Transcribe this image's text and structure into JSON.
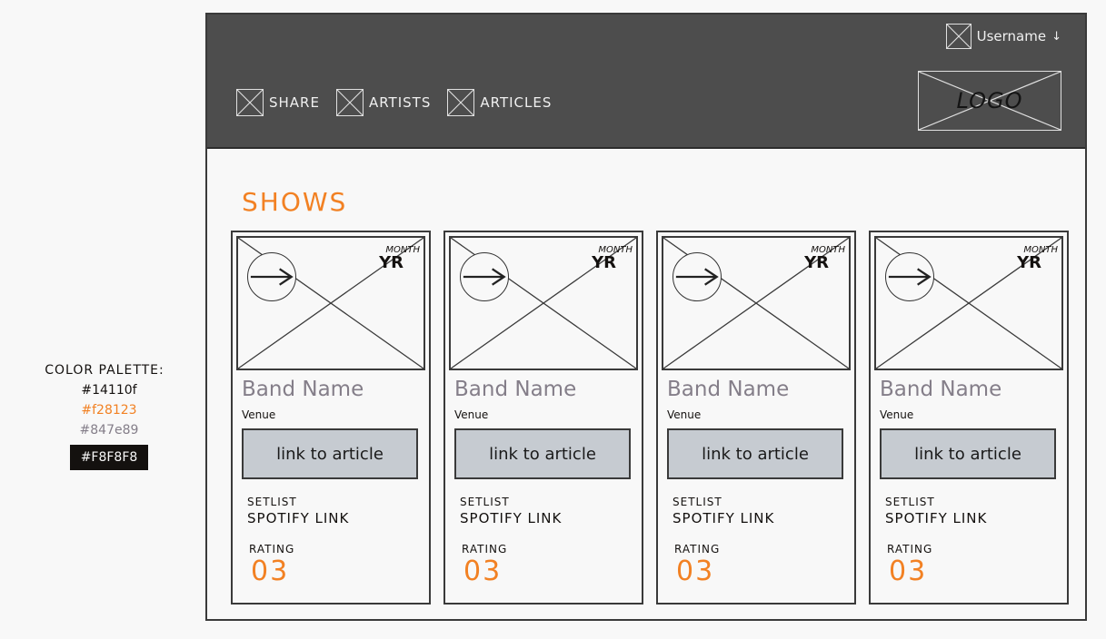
{
  "palette": {
    "title": "COLOR PALETTE:",
    "swatches": [
      "#14110f",
      "#f28123",
      "#847e89",
      "#F8F8F8"
    ]
  },
  "header": {
    "username": "Username",
    "caret": "↓",
    "nav": [
      {
        "label": "SHARE",
        "icon": "image-placeholder-icon"
      },
      {
        "label": "ARTISTS",
        "icon": "image-placeholder-icon"
      },
      {
        "label": "ARTICLES",
        "icon": "image-placeholder-icon"
      }
    ],
    "logo": "LOGO"
  },
  "main": {
    "section_title": "SHOWS",
    "cards": [
      {
        "month": "MONTH",
        "year": "YR",
        "band": "Band Name",
        "venue": "Venue",
        "link_label": "link to article",
        "setlist": "SETLIST",
        "spotify": "SPOTIFY LINK",
        "rating_label": "RATING",
        "rating": "03"
      },
      {
        "month": "MONTH",
        "year": "YR",
        "band": "Band Name",
        "venue": "Venue",
        "link_label": "link to article",
        "setlist": "SETLIST",
        "spotify": "SPOTIFY LINK",
        "rating_label": "RATING",
        "rating": "03"
      },
      {
        "month": "MONTH",
        "year": "YR",
        "band": "Band Name",
        "venue": "Venue",
        "link_label": "link to article",
        "setlist": "SETLIST",
        "spotify": "SPOTIFY LINK",
        "rating_label": "RATING",
        "rating": "03"
      },
      {
        "month": "MONTH",
        "year": "YR",
        "band": "Band Name",
        "venue": "Venue",
        "link_label": "link to article",
        "setlist": "SETLIST",
        "spotify": "SPOTIFY LINK",
        "rating_label": "RATING",
        "rating": "03"
      }
    ]
  },
  "colors": {
    "dark": "#14110f",
    "accent": "#f28123",
    "muted": "#847e89",
    "background": "#F8F8F8"
  }
}
